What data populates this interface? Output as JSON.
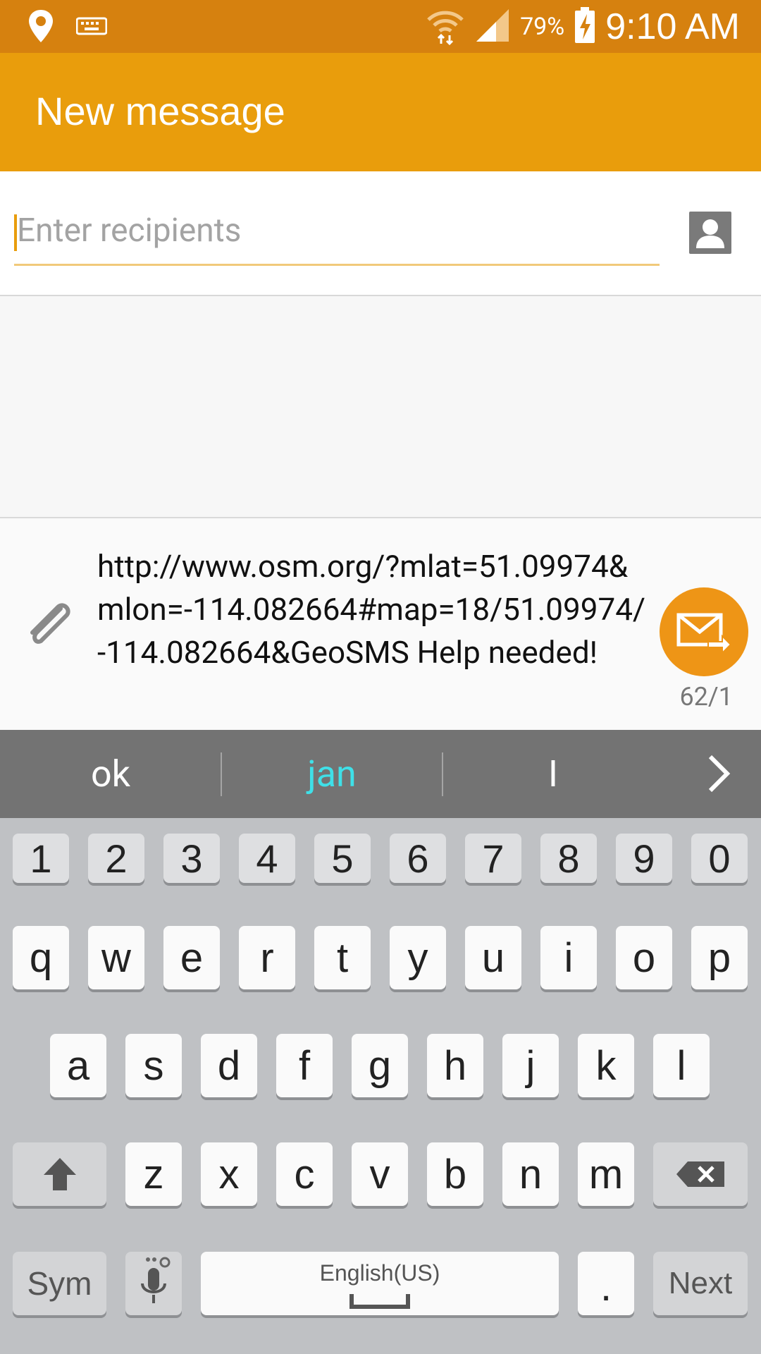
{
  "status_bar": {
    "time": "9:10 AM",
    "battery_percent": "79%",
    "icons": [
      "location-icon",
      "keyboard-icon",
      "wifi-icon",
      "signal-icon",
      "battery-charging-icon"
    ]
  },
  "action_bar": {
    "title": "New message"
  },
  "recipients": {
    "placeholder": "Enter recipients",
    "value": ""
  },
  "message": {
    "text": "http://www.osm.org/?mlat=51.09974&mlon=-114.082664#map=18/51.09974/-114.082664&GeoSMS Help needed!",
    "counter": "62/1"
  },
  "suggestions": [
    "ok",
    "jan",
    "I"
  ],
  "keyboard": {
    "numbers": [
      "1",
      "2",
      "3",
      "4",
      "5",
      "6",
      "7",
      "8",
      "9",
      "0"
    ],
    "row1": [
      "q",
      "w",
      "e",
      "r",
      "t",
      "y",
      "u",
      "i",
      "o",
      "p"
    ],
    "row2": [
      "a",
      "s",
      "d",
      "f",
      "g",
      "h",
      "j",
      "k",
      "l"
    ],
    "row3": [
      "z",
      "x",
      "c",
      "v",
      "b",
      "n",
      "m"
    ],
    "sym_label": "Sym",
    "space_label": "English(US)",
    "period_label": ".",
    "next_label": "Next"
  },
  "colors": {
    "status_bar": "#d6810f",
    "action_bar": "#e99d0c",
    "send_button": "#ee9516",
    "suggestion_highlight": "#3fe0e8"
  }
}
